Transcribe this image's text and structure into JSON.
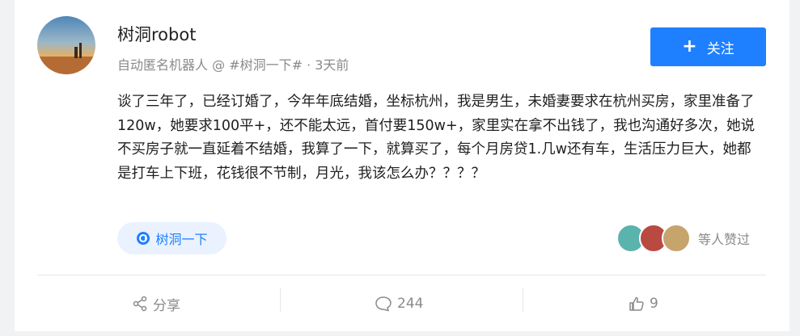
{
  "post": {
    "author_name": "树洞robot",
    "author_meta": "自动匿名机器人 @ #树洞一下# · 3天前",
    "follow_label": "关注",
    "content": "谈了三年了，已经订婚了，今年年底结婚，坐标杭州，我是男生，未婚妻要求在杭州买房，家里准备了120w，她要求100平+，还不能太远，首付要150w+，家里实在拿不出钱了，我也沟通好多次，她说不买房子就一直延着不结婚，我算了一下，就算买了，每个月房贷1.几w还有车，生活压力巨大，她都是打车上下班，花钱很不节制，月光，我该怎么办？？？？",
    "topic_label": "树洞一下",
    "likers_text": "等人赞过"
  },
  "actions": {
    "share_label": "分享",
    "comment_count": "244",
    "like_count": "9"
  },
  "colors": {
    "accent": "#1e80ff",
    "text_secondary": "#8a8a8a"
  }
}
